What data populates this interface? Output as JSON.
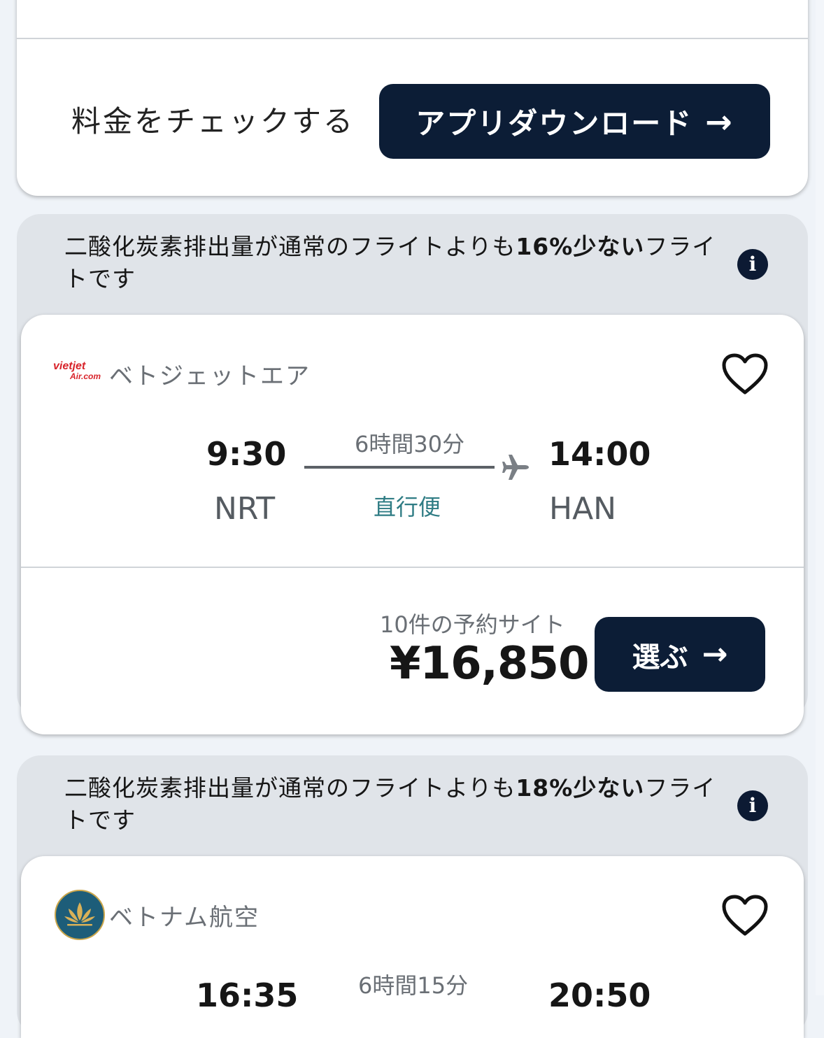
{
  "promo": {
    "check_price_label": "料金をチェックする",
    "app_download_label": "アプリダウンロード",
    "arrow": "→"
  },
  "flights": [
    {
      "eco_prefix": "二酸化炭素排出量が通常のフライトよりも",
      "eco_highlight": "16%少ない",
      "eco_suffix": "フライトです",
      "airline_name": "ベトジェットエア",
      "logo_text_top": "vietjet",
      "logo_text_bottom": "Air.com",
      "depart_time": "9:30",
      "depart_code": "NRT",
      "duration": "6時間30分",
      "stops": "直行便",
      "arrive_time": "14:00",
      "arrive_code": "HAN",
      "provider_count": "10件の予約サイト",
      "price": "¥16,850",
      "select_label": "選ぶ"
    },
    {
      "eco_prefix": "二酸化炭素排出量が通常のフライトよりも",
      "eco_highlight": "18%少ない",
      "eco_suffix": "フライトです",
      "airline_name": "ベトナム航空",
      "depart_time": "16:35",
      "duration": "6時間15分",
      "arrive_time": "20:50"
    }
  ],
  "icons": {
    "info": "info-icon",
    "favorite": "heart-outline-icon",
    "plane": "plane-icon",
    "arrow": "arrow-right-icon"
  },
  "colors": {
    "primary_dark": "#0c1d36",
    "eco_panel": "#e0e4e9",
    "direct_flight": "#2f7c84",
    "background": "#eff3f8"
  }
}
